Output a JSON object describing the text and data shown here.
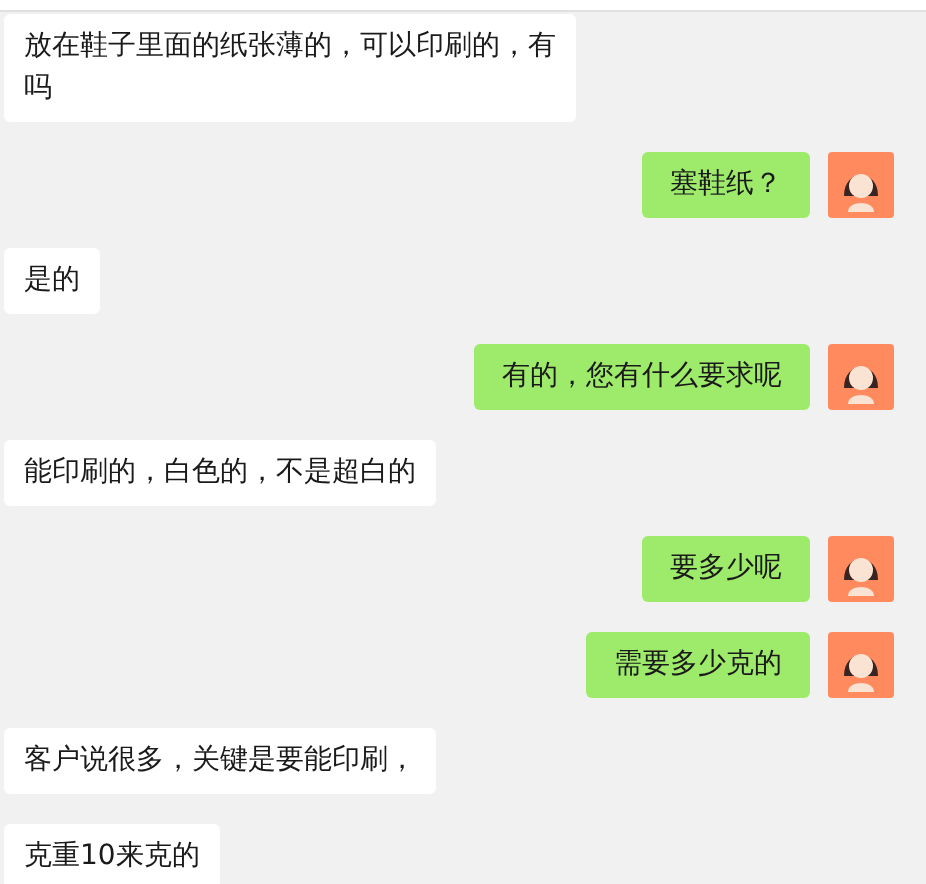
{
  "messages": [
    {
      "kind": "incoming",
      "text": "放在鞋子里面的纸张薄的，可以印刷的，有吗"
    },
    {
      "kind": "outgoing",
      "text": "塞鞋纸？"
    },
    {
      "kind": "incoming",
      "text": "是的"
    },
    {
      "kind": "outgoing",
      "text": "有的，您有什么要求呢"
    },
    {
      "kind": "incoming",
      "text": "能印刷的，白色的，不是超白的"
    },
    {
      "kind": "outgoing",
      "text": "要多少呢"
    },
    {
      "kind": "outgoing",
      "text": "需要多少克的"
    },
    {
      "kind": "incoming",
      "text": "客户说很多，关键是要能印刷，"
    },
    {
      "kind": "incoming",
      "text": "克重10来克的"
    }
  ]
}
